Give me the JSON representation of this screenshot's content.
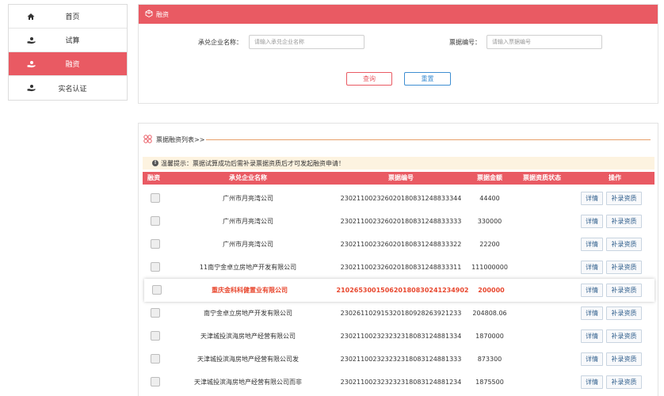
{
  "sidebar": {
    "items": [
      {
        "label": "首页",
        "icon": "home-icon"
      },
      {
        "label": "试算",
        "icon": "hand-coin-icon"
      },
      {
        "label": "融资",
        "icon": "hand-coin-icon",
        "active": true
      },
      {
        "label": "实名认证",
        "icon": "hand-coin-icon"
      }
    ]
  },
  "search_panel": {
    "title": "融资",
    "company_label": "承兑企业名称：",
    "company_placeholder": "请输入承兑企业名称",
    "bill_label": "票据编号：",
    "bill_placeholder": "请输入票据编号",
    "query_label": "查询",
    "reset_label": "重置"
  },
  "list": {
    "title": "票据融资列表>>",
    "tip": "温馨提示：票据试算成功后需补录票据资质后才可发起融资申请！",
    "columns": [
      "融资",
      "承兑企业名称",
      "票据编号",
      "票据金额",
      "票据资质状态",
      "操作"
    ],
    "detail_label": "详情",
    "supplement_label": "补录资质",
    "rows": [
      {
        "company": "广州市月亮湾公司",
        "bill_no": "230211002326020180831248833344",
        "amount": "44400",
        "status": ""
      },
      {
        "company": "广州市月亮湾公司",
        "bill_no": "230211002326020180831248833333",
        "amount": "330000",
        "status": ""
      },
      {
        "company": "广州市月亮湾公司",
        "bill_no": "230211002326020180831248833322",
        "amount": "22200",
        "status": ""
      },
      {
        "company": "11南宁金卓立房地产开发有限公司",
        "bill_no": "230211002326020180831248833311",
        "amount": "111000000",
        "status": ""
      },
      {
        "company": "重庆金科科健置业有限公司",
        "bill_no": "210265300150620180830241234902",
        "amount": "200000",
        "status": "",
        "highlighted": true
      },
      {
        "company": "南宁金卓立房地产开发有限公司",
        "bill_no": "230261102915320180928263921233",
        "amount": "204808.06",
        "status": ""
      },
      {
        "company": "天津城投滨海房地产经营有限公司",
        "bill_no": "230211002323232318083124881334",
        "amount": "1870000",
        "status": ""
      },
      {
        "company": "天津城投滨海房地产经营有限公司发",
        "bill_no": "230211002323232318083124881333",
        "amount": "873300",
        "status": ""
      },
      {
        "company": "天津城投滨海房地产经营有限公司而非",
        "bill_no": "230211002323232318083124881234",
        "amount": "1875500",
        "status": ""
      }
    ]
  },
  "colors": {
    "accent": "#e95a63",
    "reset_blue": "#3f8fd2",
    "highlight_text": "#e8472e",
    "tip_bg": "#fdf3e0"
  }
}
